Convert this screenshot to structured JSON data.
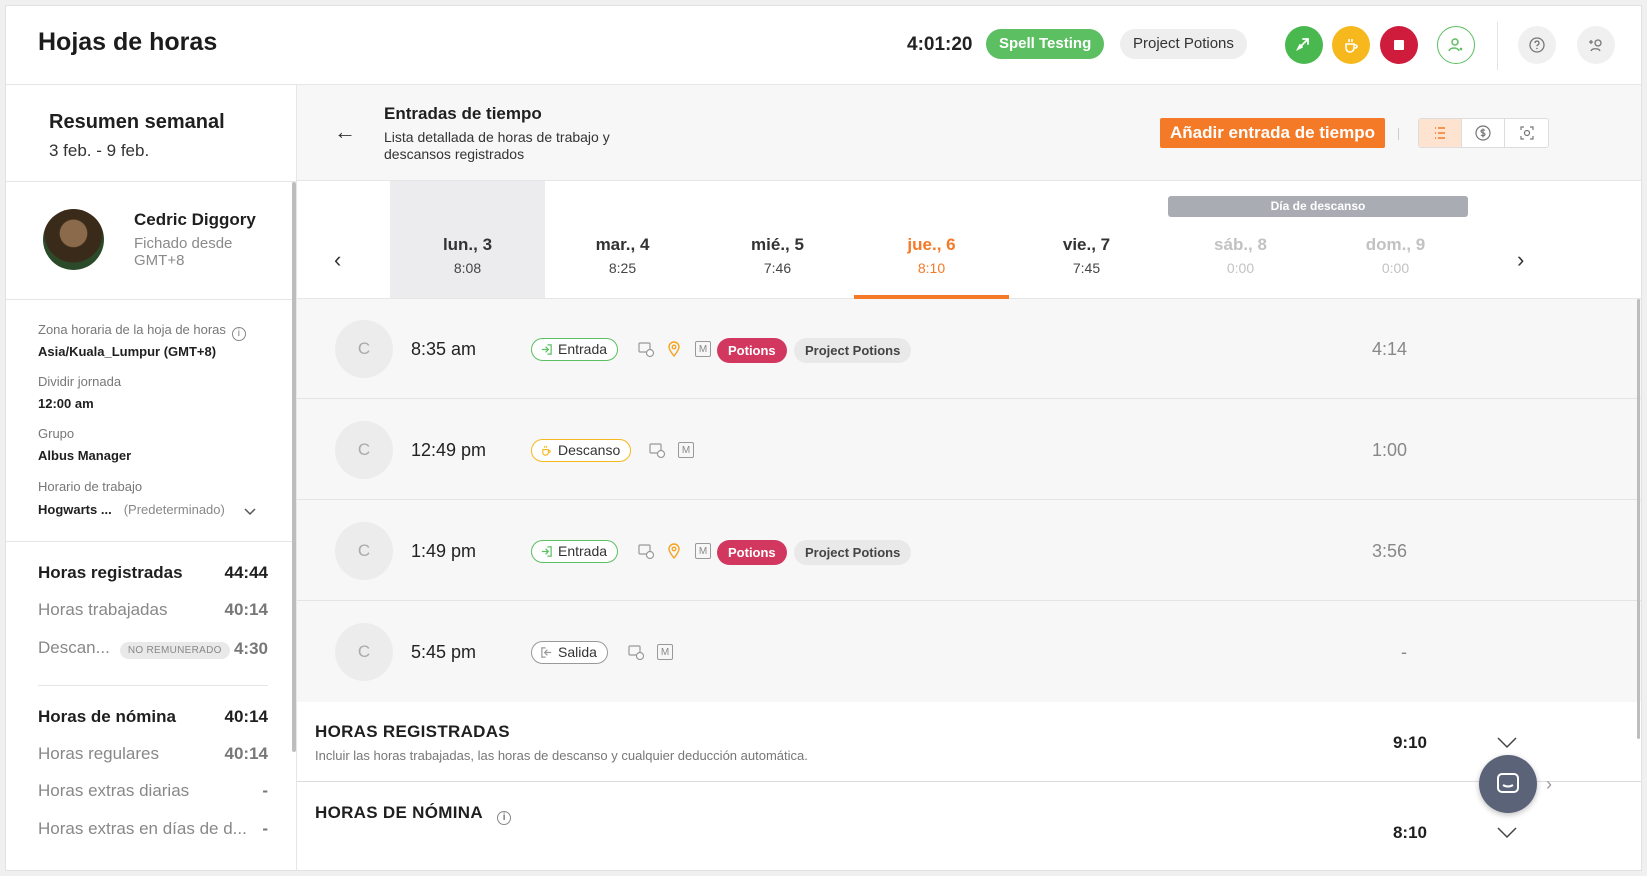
{
  "header": {
    "title": "Hojas de horas",
    "timer": "4:01:20",
    "active_activity": "Spell Testing",
    "active_project": "Project Potions",
    "accent_green": "#5cbf61",
    "accent_orange": "#f57a27",
    "stop_red": "#cf1b3c",
    "break_yellow": "#f6b81c"
  },
  "summary": {
    "title": "Resumen semanal",
    "range": "3 feb. - 9 feb."
  },
  "user": {
    "name": "Cedric Diggory",
    "subtitle": "Fichado desde GMT+8"
  },
  "info": {
    "tz_label": "Zona horaria de la hoja de horas",
    "tz_value": "Asia/Kuala_Lumpur (GMT+8)",
    "split_label": "Dividir jornada",
    "split_value": "12:00 am",
    "group_label": "Grupo",
    "group_value": "Albus Manager",
    "schedule_label": "Horario de trabajo",
    "schedule_value": "Hogwarts ...",
    "schedule_default": "(Predeterminado)"
  },
  "stats": {
    "tracked_label": "Horas registradas",
    "tracked_value": "44:44",
    "worked_label": "Horas trabajadas",
    "worked_value": "40:14",
    "breaks_label": "Descan...",
    "breaks_badge": "NO REMUNERADO",
    "breaks_value": "4:30",
    "payroll_label": "Horas de nómina",
    "payroll_value": "40:14",
    "regular_label": "Horas regulares",
    "regular_value": "40:14",
    "daily_ot_label": "Horas extras diarias",
    "daily_ot_value": "-",
    "restday_ot_label": "Horas extras en días de d...",
    "restday_ot_value": "-"
  },
  "main": {
    "title": "Entradas de tiempo",
    "subtitle": "Lista detallada de horas de trabajo y descansos registrados",
    "add_button": "Añadir entrada de tiempo",
    "day_off_label": "Día de descanso"
  },
  "days": [
    {
      "name": "lun., 3",
      "hours": "8:08"
    },
    {
      "name": "mar., 4",
      "hours": "8:25"
    },
    {
      "name": "mié., 5",
      "hours": "7:46"
    },
    {
      "name": "jue., 6",
      "hours": "8:10"
    },
    {
      "name": "vie., 7",
      "hours": "7:45"
    },
    {
      "name": "sáb., 8",
      "hours": "0:00"
    },
    {
      "name": "dom., 9",
      "hours": "0:00"
    }
  ],
  "entries": [
    {
      "initial": "C",
      "time": "8:35 am",
      "type": "Entrada",
      "activity": "Potions",
      "project": "Project Potions",
      "duration": "4:14"
    },
    {
      "initial": "C",
      "time": "12:49 pm",
      "type": "Descanso",
      "duration": "1:00"
    },
    {
      "initial": "C",
      "time": "1:49 pm",
      "type": "Entrada",
      "activity": "Potions",
      "project": "Project Potions",
      "duration": "3:56"
    },
    {
      "initial": "C",
      "time": "5:45 pm",
      "type": "Salida",
      "duration": "-"
    }
  ],
  "sections": {
    "tracked_title": "HORAS REGISTRADAS",
    "tracked_sub": "Incluir las horas trabajadas, las horas de descanso y cualquier deducción automática.",
    "tracked_value": "9:10",
    "payroll_title": "HORAS DE NÓMINA",
    "payroll_value": "8:10"
  }
}
